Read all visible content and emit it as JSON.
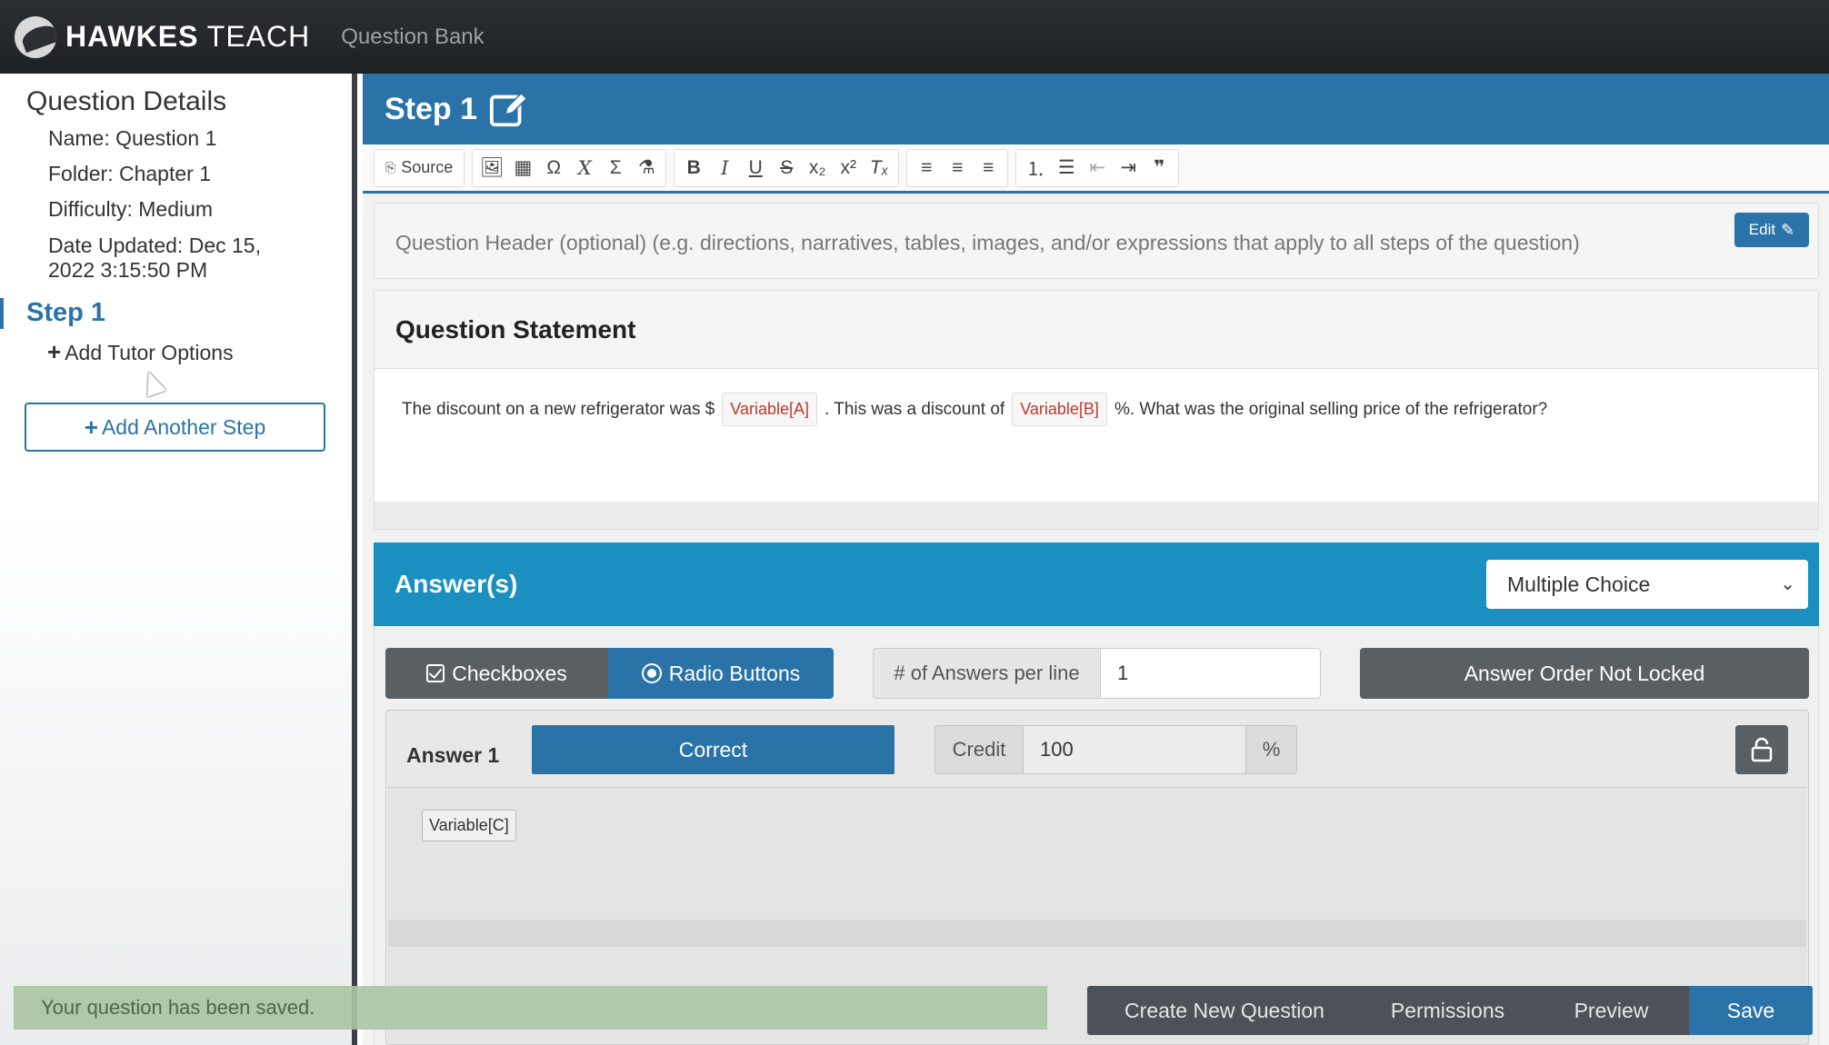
{
  "app": {
    "brand_bold": "HAWKES",
    "brand_light": "TEACH",
    "nav_link": "Question Bank"
  },
  "sidebar": {
    "title": "Question Details",
    "name": "Name: Question 1",
    "folder": "Folder: Chapter 1",
    "difficulty": "Difficulty: Medium",
    "date_updated_line1": "Date Updated: Dec 15,",
    "date_updated_line2": "2022 3:15:50 PM",
    "step_label": "Step 1",
    "add_tutor_options": "Add Tutor Options",
    "add_another_step": "Add Another Step"
  },
  "step": {
    "title": "Step 1"
  },
  "toolbar": {
    "source_label": "Source",
    "buttons": [
      "image-icon",
      "table-icon",
      "omega-icon",
      "formula-icon",
      "sigma-icon",
      "chemistry-icon",
      "bold-icon",
      "italic-icon",
      "underline-icon",
      "strike-icon",
      "subscript-icon",
      "superscript-icon",
      "remove-format-icon",
      "align-left-icon",
      "align-center-icon",
      "align-right-icon",
      "numbered-list-icon",
      "bullet-list-icon",
      "outdent-icon",
      "indent-icon",
      "blockquote-icon"
    ]
  },
  "question_header": {
    "placeholder": "Question Header (optional) (e.g. directions, narratives, tables, images, and/or expressions that apply to all steps of the question)",
    "edit_label": "Edit"
  },
  "question_statement": {
    "title": "Question Statement",
    "text_part1": "The discount on a new refrigerator was $",
    "var_a": "Variable[A]",
    "text_part2": ".  This was a discount of",
    "var_b": "Variable[B]",
    "text_part3": "%.  What was the original selling price of the refrigerator?"
  },
  "answers": {
    "title": "Answer(s)",
    "type_select": "Multiple Choice",
    "checkboxes_label": "Checkboxes",
    "radio_label": "Radio Buttons",
    "answers_per_line_label": "# of Answers per line",
    "answers_per_line_value": "1",
    "order_label": "Answer Order Not Locked",
    "answer1": {
      "label": "Answer 1",
      "correct_label": "Correct",
      "credit_label": "Credit",
      "credit_value": "100",
      "credit_unit": "%",
      "variable": "Variable[C]"
    }
  },
  "status": {
    "toast": "Your question has been saved."
  },
  "footer": {
    "create_new": "Create New Question",
    "permissions": "Permissions",
    "preview": "Preview",
    "save": "Save"
  },
  "colors": {
    "primary": "#2a73a8",
    "answers_header": "#1a8fc0",
    "dark_button": "#5a5f64",
    "topbar": "#2b2f33",
    "variable_text": "#c0392b",
    "toast_bg": "#a9c5a3"
  }
}
